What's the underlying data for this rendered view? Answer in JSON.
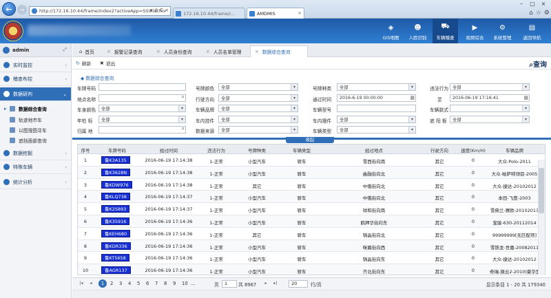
{
  "browser": {
    "address": "http://172.16.10.44/frame/index2?activeApp=SSIKiachiv",
    "address_controls": "▾ ⊘ C ×",
    "tabs": [
      {
        "label": "172.16.10.44/frame/i..."
      },
      {
        "label": "AMDMIS"
      }
    ]
  },
  "header": {
    "nav": [
      {
        "label": "GIS地图",
        "icon": "layers-icon"
      },
      {
        "label": "人脸识别",
        "icon": "face-icon"
      },
      {
        "label": "车辆稽查",
        "icon": "truck-icon",
        "active": true
      },
      {
        "label": "视频综合",
        "icon": "video-icon"
      },
      {
        "label": "系统管理",
        "icon": "gear-icon"
      },
      {
        "label": "返回导航",
        "icon": "home-icon"
      }
    ]
  },
  "sidebar": {
    "user": "admin",
    "menu": [
      {
        "label": "实时监控"
      },
      {
        "label": "稽查布控"
      },
      {
        "label": "数据研判",
        "active": true
      },
      {
        "label": "数据挖掘"
      },
      {
        "label": "特殊车辆"
      },
      {
        "label": "统计分析"
      }
    ],
    "submenu": [
      {
        "label": "数据综合查询",
        "active": true
      },
      {
        "label": "轨迹地市车"
      },
      {
        "label": "以图搜图寻车"
      },
      {
        "label": "遮挡面部查询"
      }
    ]
  },
  "page_tabs": [
    {
      "label": "首页"
    },
    {
      "label": "报警记录查询"
    },
    {
      "label": "人员身份查询"
    },
    {
      "label": "人员名单管理"
    },
    {
      "label": "数据综合查询",
      "active": true
    }
  ],
  "toolbar": {
    "refresh": "刷新",
    "exit": "退出",
    "query": "查询"
  },
  "form": {
    "title": "数据综合查询",
    "plate_no": "车牌号码",
    "location": "地点名称",
    "vehicle_color": "车身颜色",
    "vehicle_color_val": "全部",
    "year_label": "年检    标",
    "year_val": "全部",
    "belong": "归属    地",
    "plate_color": "号牌颜色",
    "plate_color_val": "全部",
    "direction": "行驶方向",
    "direction_val": "全部",
    "brand": "车辆品牌",
    "brand_val": "全部",
    "pendant": "车内挂件",
    "pendant_val": "全部",
    "source": "数据来源",
    "source_val": "全部",
    "plate_type": "号牌种类",
    "plate_type_val": "全部",
    "pass_time": "通过时间",
    "pass_time_val": "2016-6-19 00:00:00",
    "model": "车辆型号",
    "ornament": "车内摆件",
    "ornament_val": "全部",
    "car_type": "车辆类型",
    "car_type_val": "全部",
    "violation": "违法行为",
    "violation_val": "全部",
    "to": "至",
    "to_val": "2016-06-19 17:16:41",
    "style": "车辆款式",
    "visor": "遮 阳 板",
    "visor_val": "全部"
  },
  "collapse_label": "收起",
  "table": {
    "headers": [
      "序号",
      "车牌号码",
      "经过时间",
      "违法行为",
      "号牌种类",
      "车辆类型",
      "经过地点",
      "行驶方向",
      "速度(Km/H)",
      "车辆品牌"
    ],
    "rows": [
      [
        "1",
        "鲁K3A135",
        "2016-06-19 17:14:38",
        "1-正常",
        "小型汽车",
        "轿车",
        "雪西街向南",
        "其它",
        "0",
        "大众-Polo-2011"
      ],
      [
        "2",
        "鲁K3628N",
        "2016-06-19 17:14:38",
        "1-正常",
        "小型汽车",
        "轿车",
        "曲融街向北",
        "其它",
        "0",
        "大众-帕萨特领驭-2005"
      ],
      [
        "3",
        "鲁KDW976",
        "2016-06-19 17:14:38",
        "1-正常",
        "其它",
        "轿车",
        "中俄街向北",
        "其它",
        "0",
        "大众-捷达-20102012"
      ],
      [
        "4",
        "鲁KLQ738",
        "2016-06-19 17:14:37",
        "1-正常",
        "小型汽车",
        "轿车",
        "中俄街向北",
        "其它",
        "0",
        "本田-飞度-2003"
      ],
      [
        "5",
        "鲁K2S893",
        "2016-06-19 17:14:37",
        "1-正常",
        "小型汽车",
        "轿车",
        "祥和街向南",
        "其它",
        "0",
        "雪佛兰-赛欧-20102013"
      ],
      [
        "6",
        "鲁K35916",
        "2016-06-19 17:14:36",
        "1-正常",
        "小型汽车",
        "轿车",
        "鹤押华街向东",
        "其它",
        "0",
        "宝骏-630-20112014"
      ],
      [
        "7",
        "鲁KEH680",
        "2016-06-19 17:14:36",
        "1-正常",
        "其它",
        "轿车",
        "锦晶街向北",
        "其它",
        "0",
        "99999999[无匹配项]"
      ],
      [
        "8",
        "鲁KDR336",
        "2016-06-19 17:14:36",
        "1-正常",
        "小型汽车",
        "轿车",
        "咪晨街向西",
        "其它",
        "0",
        "雪铁龙-世嘉-20082011"
      ],
      [
        "9",
        "鲁KT5658",
        "2016-06-19 17:14:36",
        "1-正常",
        "小型汽车",
        "轿车",
        "锦晶街向东",
        "其它",
        "0",
        "大众-捷达-20102012"
      ],
      [
        "10",
        "鲁AGR137",
        "2016-06-19 17:14:36",
        "1-正常",
        "小型汽车",
        "轿车",
        "齐北街向东",
        "其它",
        "0",
        "奇瑞-旗云2-2010(豪华型)"
      ]
    ]
  },
  "pager": {
    "pages": [
      "1",
      "2",
      "3",
      "4",
      "5",
      "6",
      "7",
      "8",
      "9",
      "10",
      "..."
    ],
    "page_label": "页",
    "current": "1",
    "total": "共 8967",
    "page_size": "20",
    "per_page": "行/页",
    "summary": "显示条目 1 - 20 共 179340"
  }
}
